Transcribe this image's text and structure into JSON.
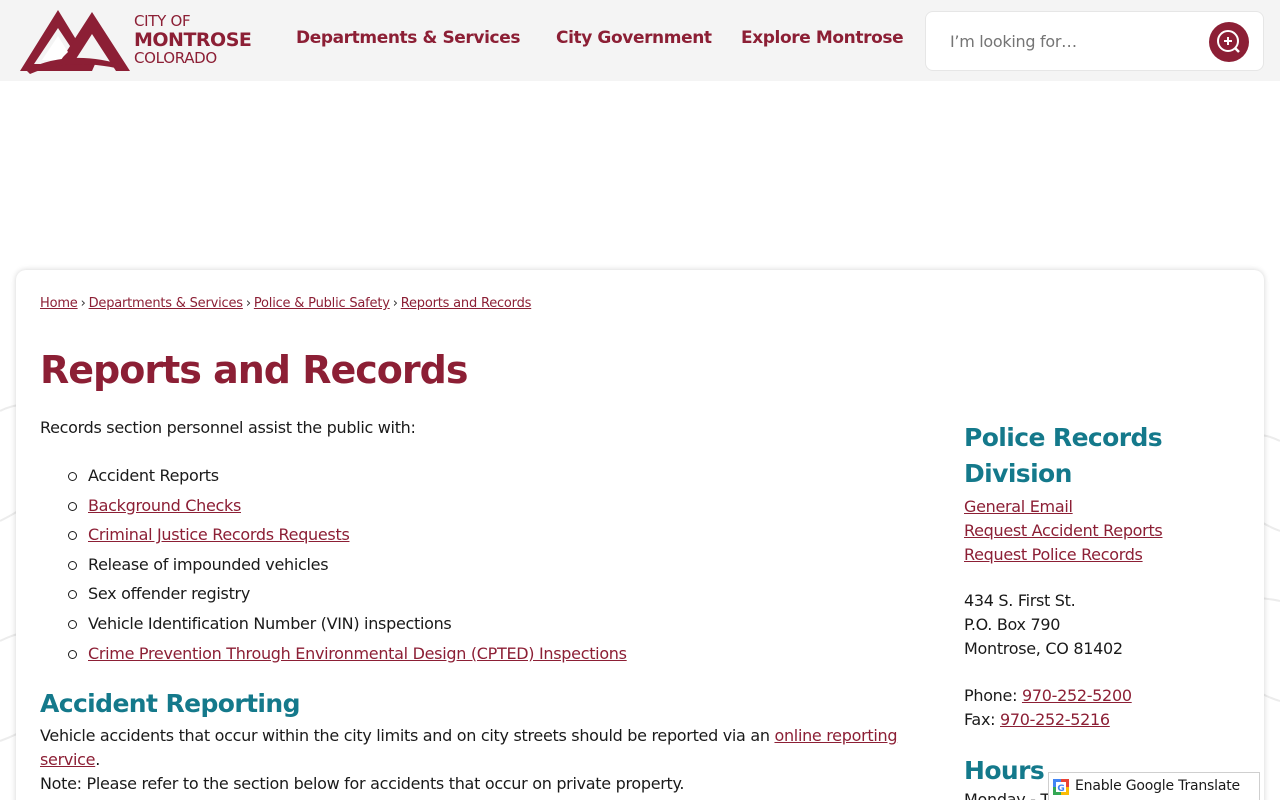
{
  "header": {
    "logo": {
      "line1": "CITY OF",
      "line2": "MONTROSE",
      "line3": "COLORADO"
    },
    "nav": [
      "Departments & Services",
      "City Government",
      "Explore Montrose"
    ],
    "search": {
      "placeholder": "I’m looking for…",
      "value": ""
    }
  },
  "breadcrumb": [
    "Home",
    "Departments & Services",
    "Police & Public Safety",
    "Reports and Records"
  ],
  "main": {
    "title": "Reports and Records",
    "intro": "Records section personnel assist the public with:",
    "services": [
      {
        "text": "Accident Reports",
        "link": false
      },
      {
        "text": "Background Checks",
        "link": true
      },
      {
        "text": "Criminal Justice Records Requests",
        "link": true
      },
      {
        "text": "Release of impounded vehicles",
        "link": false
      },
      {
        "text": "Sex offender registry",
        "link": false
      },
      {
        "text": "Vehicle Identification Number (VIN) inspections",
        "link": false
      },
      {
        "text": "Crime Prevention Through Environmental Design (CPTED) Inspections",
        "link": true
      }
    ],
    "accident_heading": "Accident Reporting",
    "accident_text_before": "Vehicle accidents that occur within the city limits and on city streets should be reported via an ",
    "accident_link": "online reporting service",
    "accident_text_after": ".",
    "accident_note": "Note: Please refer to the section below for accidents that occur on private property."
  },
  "sidebar": {
    "title": "Police Records Division",
    "links": [
      "General Email",
      "Request Accident Reports",
      "Request Police Records"
    ],
    "address": [
      "434 S. First St.",
      "P.O. Box 790",
      "Montrose, CO 81402"
    ],
    "phone_label": "Phone: ",
    "phone": "970-252-5200",
    "fax_label": "Fax: ",
    "fax": "970-252-5216",
    "hours_heading": "Hours",
    "hours_text": "Monday - Th"
  },
  "translate": {
    "label": "Enable Google Translate"
  },
  "colors": {
    "brand": "#8c1f35",
    "accent": "#14798b"
  },
  "icons": {
    "search": "search-plus-icon",
    "translate": "google-translate-icon"
  }
}
